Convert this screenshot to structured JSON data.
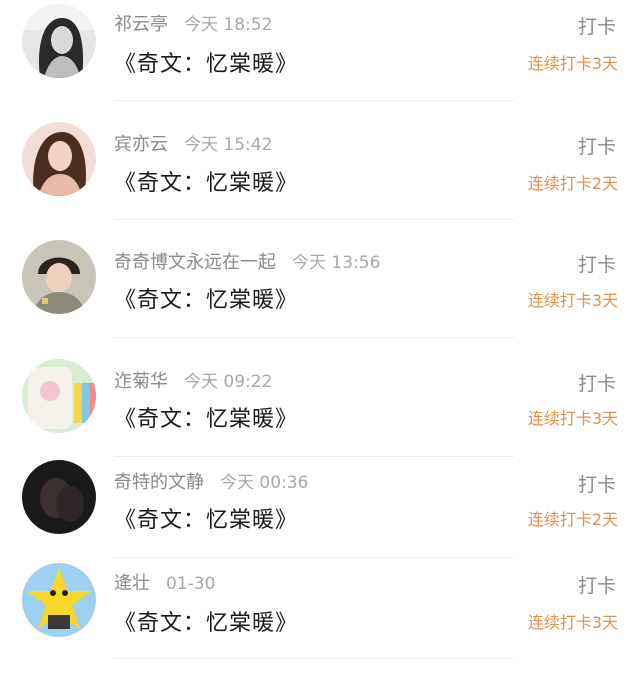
{
  "checkins": [
    {
      "name": "祁云亭",
      "time": "今天 18:52",
      "title": "《奇文：忆棠暖》",
      "action": "打卡",
      "streak": "连续打卡3天",
      "avatar": "avatar-girl-bw"
    },
    {
      "name": "宾亦云",
      "time": "今天 15:42",
      "title": "《奇文：忆棠暖》",
      "action": "打卡",
      "streak": "连续打卡2天",
      "avatar": "avatar-girl-pink"
    },
    {
      "name": "奇奇博文永远在一起",
      "time": "今天 13:56",
      "title": "《奇文：忆棠暖》",
      "action": "打卡",
      "streak": "连续打卡3天",
      "avatar": "avatar-boy"
    },
    {
      "name": "迮菊华",
      "time": "今天 09:22",
      "title": "《奇文：忆棠暖》",
      "action": "打卡",
      "streak": "连续打卡3天",
      "avatar": "avatar-cartoon-phone"
    },
    {
      "name": "奇特的文静",
      "time": "今天 00:36",
      "title": "《奇文：忆棠暖》",
      "action": "打卡",
      "streak": "连续打卡2天",
      "avatar": "avatar-dark"
    },
    {
      "name": "逄壮",
      "time": "01-30",
      "title": "《奇文：忆棠暖》",
      "action": "打卡",
      "streak": "连续打卡3天",
      "avatar": "avatar-star"
    }
  ],
  "colors": {
    "accent": "#e0914a",
    "name": "#8a8a8a",
    "title": "#1a1a1a",
    "divider": "#ececec"
  }
}
